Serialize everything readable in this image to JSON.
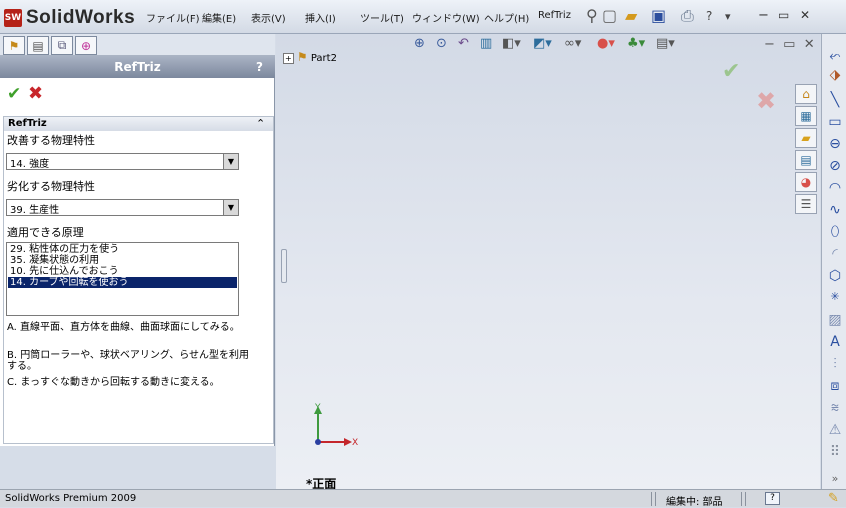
{
  "app": {
    "name": "SolidWorks",
    "logo_badge": "SW"
  },
  "menu": [
    "ファイル(F)",
    "編集(E)",
    "表示(V)",
    "挿入(I)",
    "ツール(T)",
    "ウィンドウ(W)",
    "ヘルプ(H)",
    "RefTriz"
  ],
  "panel": {
    "title": "RefTriz",
    "help_label": "?",
    "group_title": "RefTriz",
    "improve_label": "改善する物理特性",
    "improve_value": "14. 強度",
    "worsen_label": "劣化する物理特性",
    "worsen_value": "39. 生産性",
    "principles_label": "適用できる原理",
    "principles": [
      "29. 粘性体の圧力を使う",
      "35. 凝集状態の利用",
      "10. 先に仕込んでおこう",
      "14. カーブや回転を使おう"
    ],
    "selected_principle_index": 3,
    "descriptions": [
      "A. 直線平面、直方体を曲線、曲面球面にしてみる。",
      "B. 円筒ローラーや、球状ベアリング、らせん型を利用する。",
      "C. まっすぐな動きから回転する動きに変える。"
    ]
  },
  "graphics": {
    "tree_item": "Part2",
    "view_label": "*正面",
    "axis_y": "Y",
    "axis_x": "X"
  },
  "status": {
    "product": "SolidWorks Premium 2009",
    "mode": "編集中: 部品",
    "help": "?"
  },
  "colors": {
    "ok_green": "#3fa02b",
    "cancel_red": "#c8262b",
    "selection": "#0a246a",
    "header_bar": "#7c889d"
  },
  "icons": {
    "toolbar": [
      "zoom-fit-icon",
      "zoom-area-icon",
      "previous-view-icon",
      "section-view-icon",
      "view-orientation-icon",
      "display-style-icon",
      "hide-show-icon",
      "appearance-icon",
      "scene-icon",
      "view-settings-icon"
    ],
    "task_pane": [
      "home-icon",
      "design-library-icon",
      "file-explorer-icon",
      "view-palette-icon",
      "appearances-icon",
      "custom-properties-icon"
    ],
    "sketch": [
      "smart-dimension-icon",
      "line-icon",
      "rectangle-icon",
      "slot-icon",
      "circle-icon",
      "arc-icon",
      "spline-icon",
      "ellipse-icon",
      "fillet-icon",
      "polygon-icon",
      "point-icon",
      "centerline-icon",
      "text-icon",
      "mirror-icon",
      "offset-icon",
      "trim-icon",
      "warning-icon",
      "grid-icon"
    ]
  }
}
